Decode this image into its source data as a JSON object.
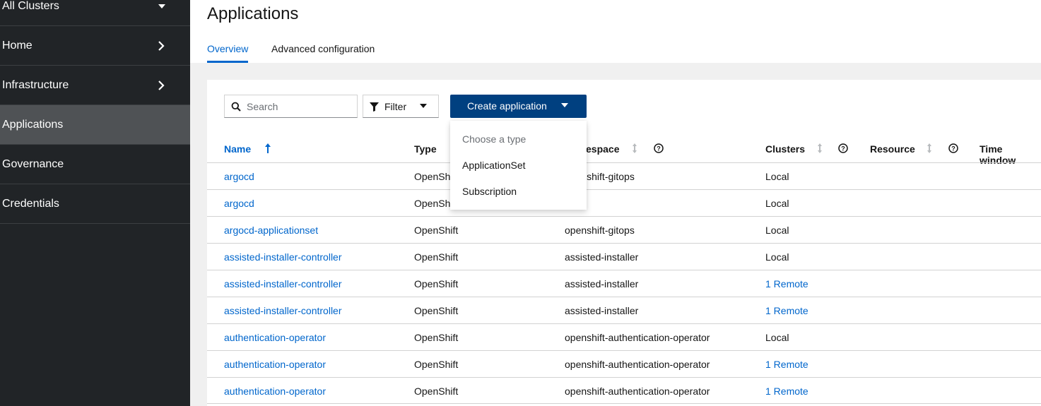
{
  "sidebar": {
    "cluster_selector": "All Clusters",
    "items": [
      {
        "label": "Home"
      },
      {
        "label": "Infrastructure"
      },
      {
        "label": "Applications"
      },
      {
        "label": "Governance"
      },
      {
        "label": "Credentials"
      }
    ]
  },
  "header": {
    "title": "Applications",
    "tabs": [
      {
        "label": "Overview",
        "active": true
      },
      {
        "label": "Advanced configuration",
        "active": false
      }
    ]
  },
  "toolbar": {
    "search_placeholder": "Search",
    "filter_label": "Filter",
    "create_label": "Create application"
  },
  "dropdown": {
    "title": "Choose a type",
    "items": [
      "ApplicationSet",
      "Subscription"
    ]
  },
  "table": {
    "columns": [
      "Name",
      "Type",
      "Namespace",
      "Clusters",
      "Resource",
      "Time window"
    ],
    "namespace_header_visible": "espace",
    "rows": [
      {
        "name": "argocd",
        "type": "OpenShift",
        "namespace": "openshift-gitops",
        "clusters": "Local"
      },
      {
        "name": "argocd",
        "type": "OpenShift",
        "namespace": "",
        "clusters": "Local"
      },
      {
        "name": "argocd-applicationset",
        "type": "OpenShift",
        "namespace": "openshift-gitops",
        "clusters": "Local"
      },
      {
        "name": "assisted-installer-controller",
        "type": "OpenShift",
        "namespace": "assisted-installer",
        "clusters": "Local"
      },
      {
        "name": "assisted-installer-controller",
        "type": "OpenShift",
        "namespace": "assisted-installer",
        "clusters": "1 Remote"
      },
      {
        "name": "assisted-installer-controller",
        "type": "OpenShift",
        "namespace": "assisted-installer",
        "clusters": "1 Remote"
      },
      {
        "name": "authentication-operator",
        "type": "OpenShift",
        "namespace": "openshift-authentication-operator",
        "clusters": "Local"
      },
      {
        "name": "authentication-operator",
        "type": "OpenShift",
        "namespace": "openshift-authentication-operator",
        "clusters": "1 Remote"
      },
      {
        "name": "authentication-operator",
        "type": "OpenShift",
        "namespace": "openshift-authentication-operator",
        "clusters": "1 Remote"
      }
    ]
  },
  "colors": {
    "sidebar_bg": "#212427",
    "active_nav": "#4f5255",
    "link": "#0066cc",
    "primary_button": "#004080"
  }
}
